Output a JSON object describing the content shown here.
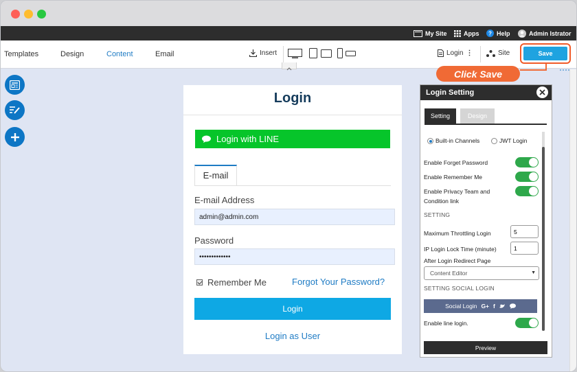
{
  "topbar": {
    "my_site": "My Site",
    "apps": "Apps",
    "help": "Help",
    "user": "Admin Istrator"
  },
  "toolbar": {
    "tabs": [
      "Templates",
      "Design",
      "Content",
      "Email"
    ],
    "active_tab": "Content",
    "insert": "Insert",
    "login": "Login",
    "site": "Site",
    "save": "Save"
  },
  "callout": "Click Save",
  "login_form": {
    "title": "Login",
    "line_button": "Login with LINE",
    "tab": "E-mail",
    "email_label": "E-mail Address",
    "email_value": "admin@admin.com",
    "password_label": "Password",
    "password_value": "•••••••••••••",
    "remember": "Remember Me",
    "forgot": "Forgot Your Password?",
    "submit": "Login",
    "login_as_user": "Login as User"
  },
  "panel": {
    "title": "Login Setting",
    "tabs": [
      "Setting",
      "Design"
    ],
    "radio_builtin": "Built-in Channels",
    "radio_jwt": "JWT Login",
    "forget_password": "Enable Forget Password",
    "remember_me": "Enable Remember Me",
    "privacy_line1": "Enable Privacy Team and",
    "privacy_line2": "Condition link",
    "section_setting": "SETTING",
    "max_throttling": "Maximum Throttling Login",
    "max_throttling_value": "5",
    "lock_time": "IP Login Lock Time (minute)",
    "lock_time_value": "1",
    "redirect": "After Login Redirect Page",
    "redirect_value": "Content Editor",
    "section_social": "SETTING SOCIAL LOGIN",
    "social_login": "Social Login",
    "line_login": "Enable line login.",
    "preview": "Preview"
  },
  "colors": {
    "accent": "#1e7bc4",
    "save": "#1fa3e0",
    "line_green": "#06c52a",
    "callout": "#f06a35",
    "toggle_on": "#2ea84b"
  }
}
